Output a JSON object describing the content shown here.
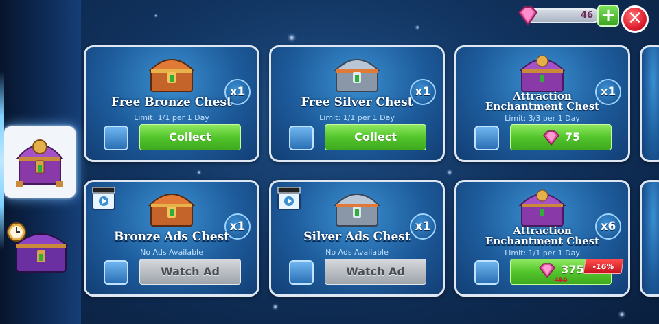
{
  "currency": {
    "gems": "46",
    "add_label": "+",
    "close_label": "✕"
  },
  "sidebar": {
    "tabs": [
      {
        "name": "attraction-chests",
        "icon": "purple-chest-icon",
        "active": true
      },
      {
        "name": "timed-chests",
        "icon": "clock-chest-icon",
        "active": false
      }
    ]
  },
  "cards": [
    {
      "title": "Free Bronze Chest",
      "sub": "Limit: 1/1 per 1 Day",
      "qty": "x1",
      "button": "Collect",
      "button_style": "green",
      "chest": "bronze"
    },
    {
      "title": "Free Silver Chest",
      "sub": "Limit: 1/1 per 1 Day",
      "qty": "x1",
      "button": "Collect",
      "button_style": "green",
      "chest": "silver"
    },
    {
      "title_l1": "Attraction",
      "title_l2": "Enchantment Chest",
      "sub": "Limit: 3/3 per 1 Day",
      "qty": "x1",
      "price": "75",
      "chest": "purple"
    },
    {
      "title": "Bronze Ads Chest",
      "sub": "No Ads Available",
      "qty": "x1",
      "button": "Watch Ad",
      "button_style": "grey",
      "chest": "bronze"
    },
    {
      "title": "Silver Ads Chest",
      "sub": "No Ads Available",
      "qty": "x1",
      "button": "Watch Ad",
      "button_style": "grey",
      "chest": "silver"
    },
    {
      "title_l1": "Attraction",
      "title_l2": "Enchantment Chest",
      "sub": "Limit: 1/1 per 1 Day",
      "qty": "x6",
      "price": "375",
      "old_price": "450",
      "discount": "-16%",
      "chest": "purple"
    }
  ],
  "colors": {
    "accent_green": "#53c52c",
    "disabled_grey": "#9ea4ab",
    "close_red": "#e01e2e",
    "gem_pink": "#e0509a"
  }
}
